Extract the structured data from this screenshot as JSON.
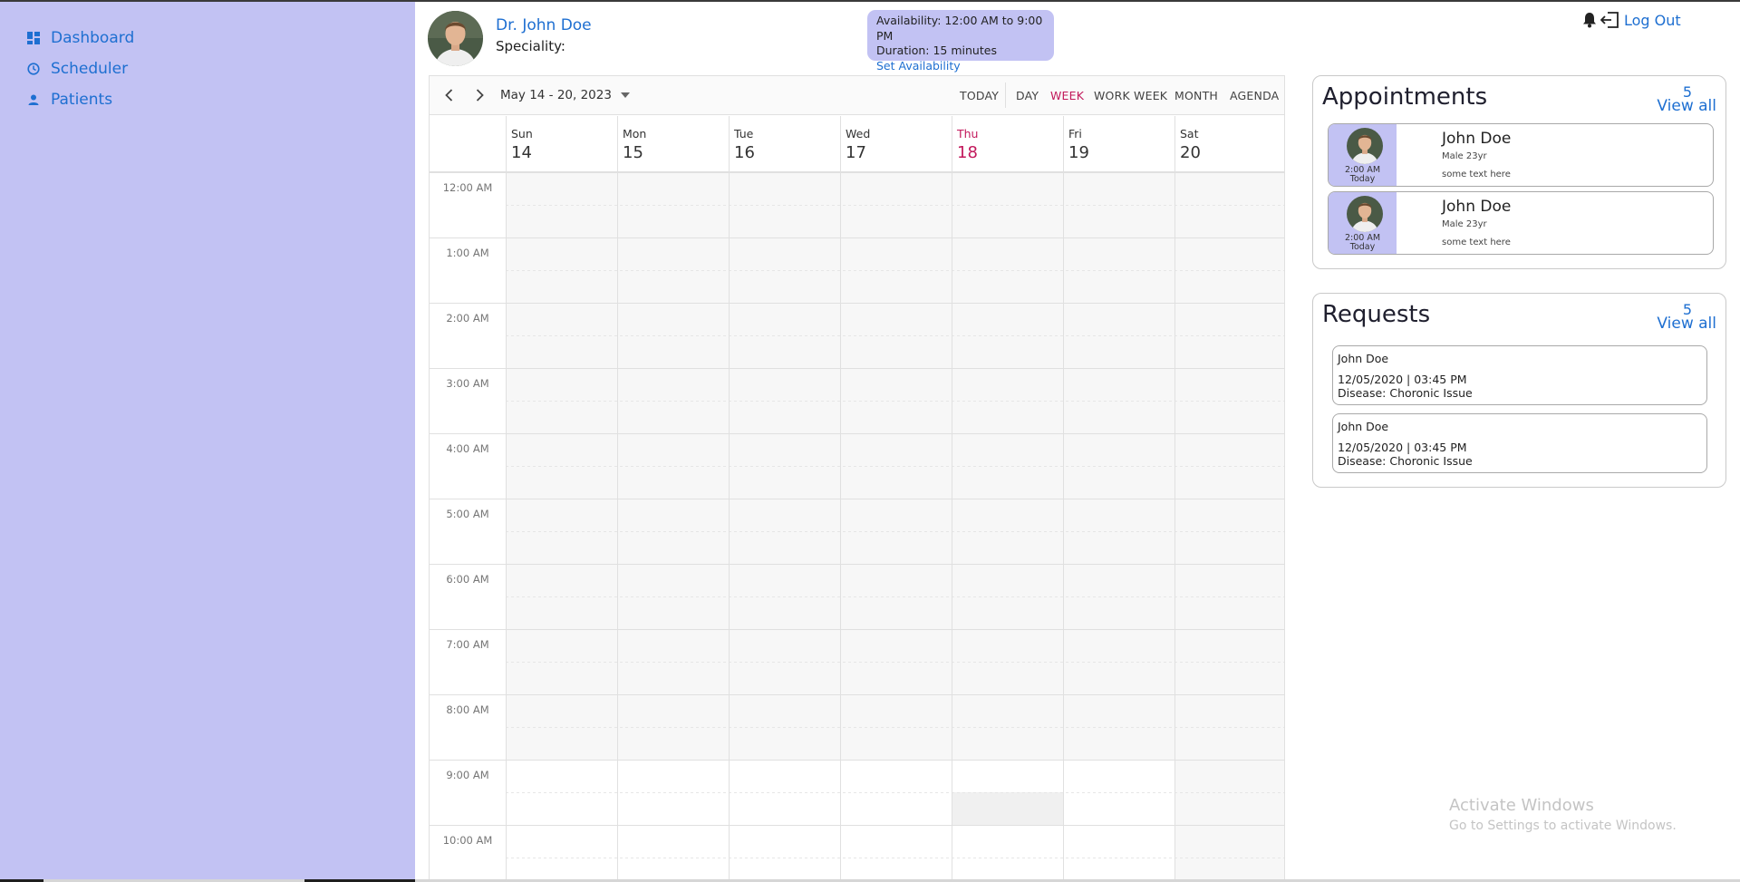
{
  "sidebar": {
    "items": [
      {
        "label": "Dashboard",
        "icon": "dashboard-icon"
      },
      {
        "label": "Scheduler",
        "icon": "clock-icon"
      },
      {
        "label": "Patients",
        "icon": "person-icon"
      }
    ]
  },
  "header": {
    "doctor_name": "Dr. John Doe",
    "speciality_label": "Speciality:",
    "availability": "Availability: 12:00 AM to 9:00 PM",
    "duration": "Duration: 15 minutes",
    "set_availability": "Set Availability",
    "logout": "Log Out",
    "icons": [
      "bell-icon",
      "logout-icon"
    ]
  },
  "scheduler": {
    "date_range": "May 14 - 20, 2023",
    "views": [
      "TODAY",
      "DAY",
      "WEEK",
      "WORK WEEK",
      "MONTH",
      "AGENDA"
    ],
    "active_view": "WEEK",
    "days": [
      {
        "name": "Sun",
        "date": "14"
      },
      {
        "name": "Mon",
        "date": "15"
      },
      {
        "name": "Tue",
        "date": "16"
      },
      {
        "name": "Wed",
        "date": "17"
      },
      {
        "name": "Thu",
        "date": "18",
        "today": true
      },
      {
        "name": "Fri",
        "date": "19"
      },
      {
        "name": "Sat",
        "date": "20"
      }
    ],
    "times": [
      "12:00 AM",
      "1:00 AM",
      "2:00 AM",
      "3:00 AM",
      "4:00 AM",
      "5:00 AM",
      "6:00 AM",
      "7:00 AM",
      "8:00 AM",
      "9:00 AM",
      "10:00 AM"
    ],
    "colors": {
      "today": "#c2185b",
      "off_hours": "#f7f7f7",
      "grid": "#e0e0e0"
    }
  },
  "appointments": {
    "title": "Appointments",
    "count": "5",
    "view_all": "View all",
    "items": [
      {
        "time": "2:00 AM",
        "day": "Today",
        "name": "John Doe",
        "info": "Male 23yr",
        "note": "some text here"
      },
      {
        "time": "2:00 AM",
        "day": "Today",
        "name": "John Doe",
        "info": "Male 23yr",
        "note": "some text here"
      }
    ]
  },
  "requests": {
    "title": "Requests",
    "count": "5",
    "view_all": "View all",
    "items": [
      {
        "name": "John Doe",
        "datetime": "12/05/2020 | 03:45 PM",
        "disease": "Disease: Choronic Issue"
      },
      {
        "name": "John Doe",
        "datetime": "12/05/2020 | 03:45 PM",
        "disease": "Disease: Choronic Issue"
      }
    ]
  },
  "watermark": {
    "line1": "Activate Windows",
    "line2": "Go to Settings to activate Windows."
  },
  "theme": {
    "accent": "#1e6fd1",
    "sidebar_bg": "#c2c2f3"
  }
}
